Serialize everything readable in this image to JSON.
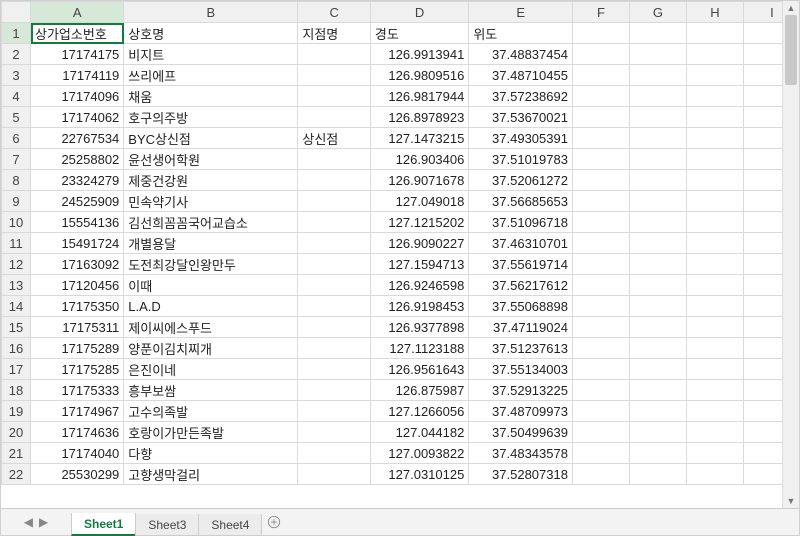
{
  "columns": [
    "A",
    "B",
    "C",
    "D",
    "E",
    "F",
    "G",
    "H",
    "I"
  ],
  "headers": {
    "A": "상가업소번호",
    "B": "상호명",
    "C": "지점명",
    "D": "경도",
    "E": "위도"
  },
  "rows": [
    {
      "n": 1,
      "A": "상가업소번호",
      "B": "상호명",
      "C": "지점명",
      "D": "경도",
      "E": "위도",
      "hdr": true
    },
    {
      "n": 2,
      "A": "17174175",
      "B": "비지트",
      "C": "",
      "D": "126.9913941",
      "E": "37.48837454"
    },
    {
      "n": 3,
      "A": "17174119",
      "B": "쓰리에프",
      "C": "",
      "D": "126.9809516",
      "E": "37.48710455"
    },
    {
      "n": 4,
      "A": "17174096",
      "B": "채움",
      "C": "",
      "D": "126.9817944",
      "E": "37.57238692"
    },
    {
      "n": 5,
      "A": "17174062",
      "B": "호구의주방",
      "C": "",
      "D": "126.8978923",
      "E": "37.53670021"
    },
    {
      "n": 6,
      "A": "22767534",
      "B": "BYC상신점",
      "C": "상신점",
      "D": "127.1473215",
      "E": "37.49305391"
    },
    {
      "n": 7,
      "A": "25258802",
      "B": "윤선생어학원",
      "C": "",
      "D": "126.903406",
      "E": "37.51019783"
    },
    {
      "n": 8,
      "A": "23324279",
      "B": "제중건강원",
      "C": "",
      "D": "126.9071678",
      "E": "37.52061272"
    },
    {
      "n": 9,
      "A": "24525909",
      "B": "민속약기사",
      "C": "",
      "D": "127.049018",
      "E": "37.56685653"
    },
    {
      "n": 10,
      "A": "15554136",
      "B": "김선희꼼꼼국어교습소",
      "C": "",
      "D": "127.1215202",
      "E": "37.51096718"
    },
    {
      "n": 11,
      "A": "15491724",
      "B": "개별용달",
      "C": "",
      "D": "126.9090227",
      "E": "37.46310701"
    },
    {
      "n": 12,
      "A": "17163092",
      "B": "도전최강달인왕만두",
      "C": "",
      "D": "127.1594713",
      "E": "37.55619714"
    },
    {
      "n": 13,
      "A": "17120456",
      "B": "이때",
      "C": "",
      "D": "126.9246598",
      "E": "37.56217612"
    },
    {
      "n": 14,
      "A": "17175350",
      "B": "L.A.D",
      "C": "",
      "D": "126.9198453",
      "E": "37.55068898"
    },
    {
      "n": 15,
      "A": "17175311",
      "B": "제이씨에스푸드",
      "C": "",
      "D": "126.9377898",
      "E": "37.47119024"
    },
    {
      "n": 16,
      "A": "17175289",
      "B": "양푼이김치찌개",
      "C": "",
      "D": "127.1123188",
      "E": "37.51237613"
    },
    {
      "n": 17,
      "A": "17175285",
      "B": "은진이네",
      "C": "",
      "D": "126.9561643",
      "E": "37.55134003"
    },
    {
      "n": 18,
      "A": "17175333",
      "B": "흥부보쌈",
      "C": "",
      "D": "126.875987",
      "E": "37.52913225"
    },
    {
      "n": 19,
      "A": "17174967",
      "B": "고수의족발",
      "C": "",
      "D": "127.1266056",
      "E": "37.48709973"
    },
    {
      "n": 20,
      "A": "17174636",
      "B": "호랑이가만든족발",
      "C": "",
      "D": "127.044182",
      "E": "37.50499639"
    },
    {
      "n": 21,
      "A": "17174040",
      "B": "다향",
      "C": "",
      "D": "127.0093822",
      "E": "37.48343578"
    },
    {
      "n": 22,
      "A": "25530299",
      "B": "고향생막걸리",
      "C": "",
      "D": "127.0310125",
      "E": "37.52807318"
    }
  ],
  "selected": {
    "row": 1,
    "col": "A"
  },
  "sheets": [
    {
      "name": "Sheet1",
      "active": true
    },
    {
      "name": "Sheet3",
      "active": false
    },
    {
      "name": "Sheet4",
      "active": false
    }
  ],
  "icons": {
    "nav_first": "⏮",
    "nav_prev": "◀",
    "nav_next": "▶",
    "nav_last": "⏭"
  }
}
